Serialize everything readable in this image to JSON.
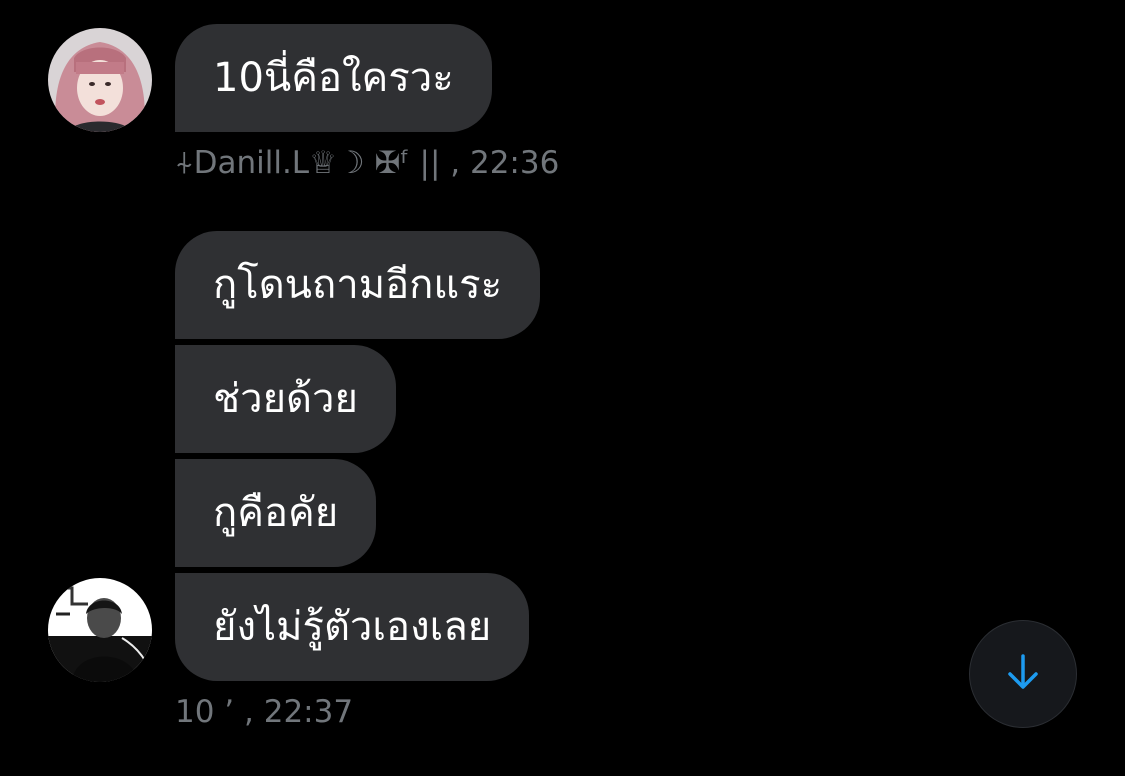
{
  "group1": {
    "messages": [
      {
        "text": "10นี่คือใครวะ"
      }
    ],
    "sender": "⍭Danill.L♕☽ ✠ᶠ ||",
    "time": ", 22:36"
  },
  "group2": {
    "messages": [
      {
        "text": "กูโดนถามอีกแระ"
      },
      {
        "text": "ช่วยด้วย"
      },
      {
        "text": "กูคือคัย"
      },
      {
        "text": "ยังไม่รู้ตัวเองเลย"
      }
    ],
    "sender": "10 ’",
    "time": ", 22:37"
  },
  "colors": {
    "background": "#000000",
    "bubble": "#2f3033",
    "meta_text": "#71767b",
    "accent": "#1d9bf0"
  },
  "icons": {
    "scroll_button": "arrow-down-icon"
  }
}
